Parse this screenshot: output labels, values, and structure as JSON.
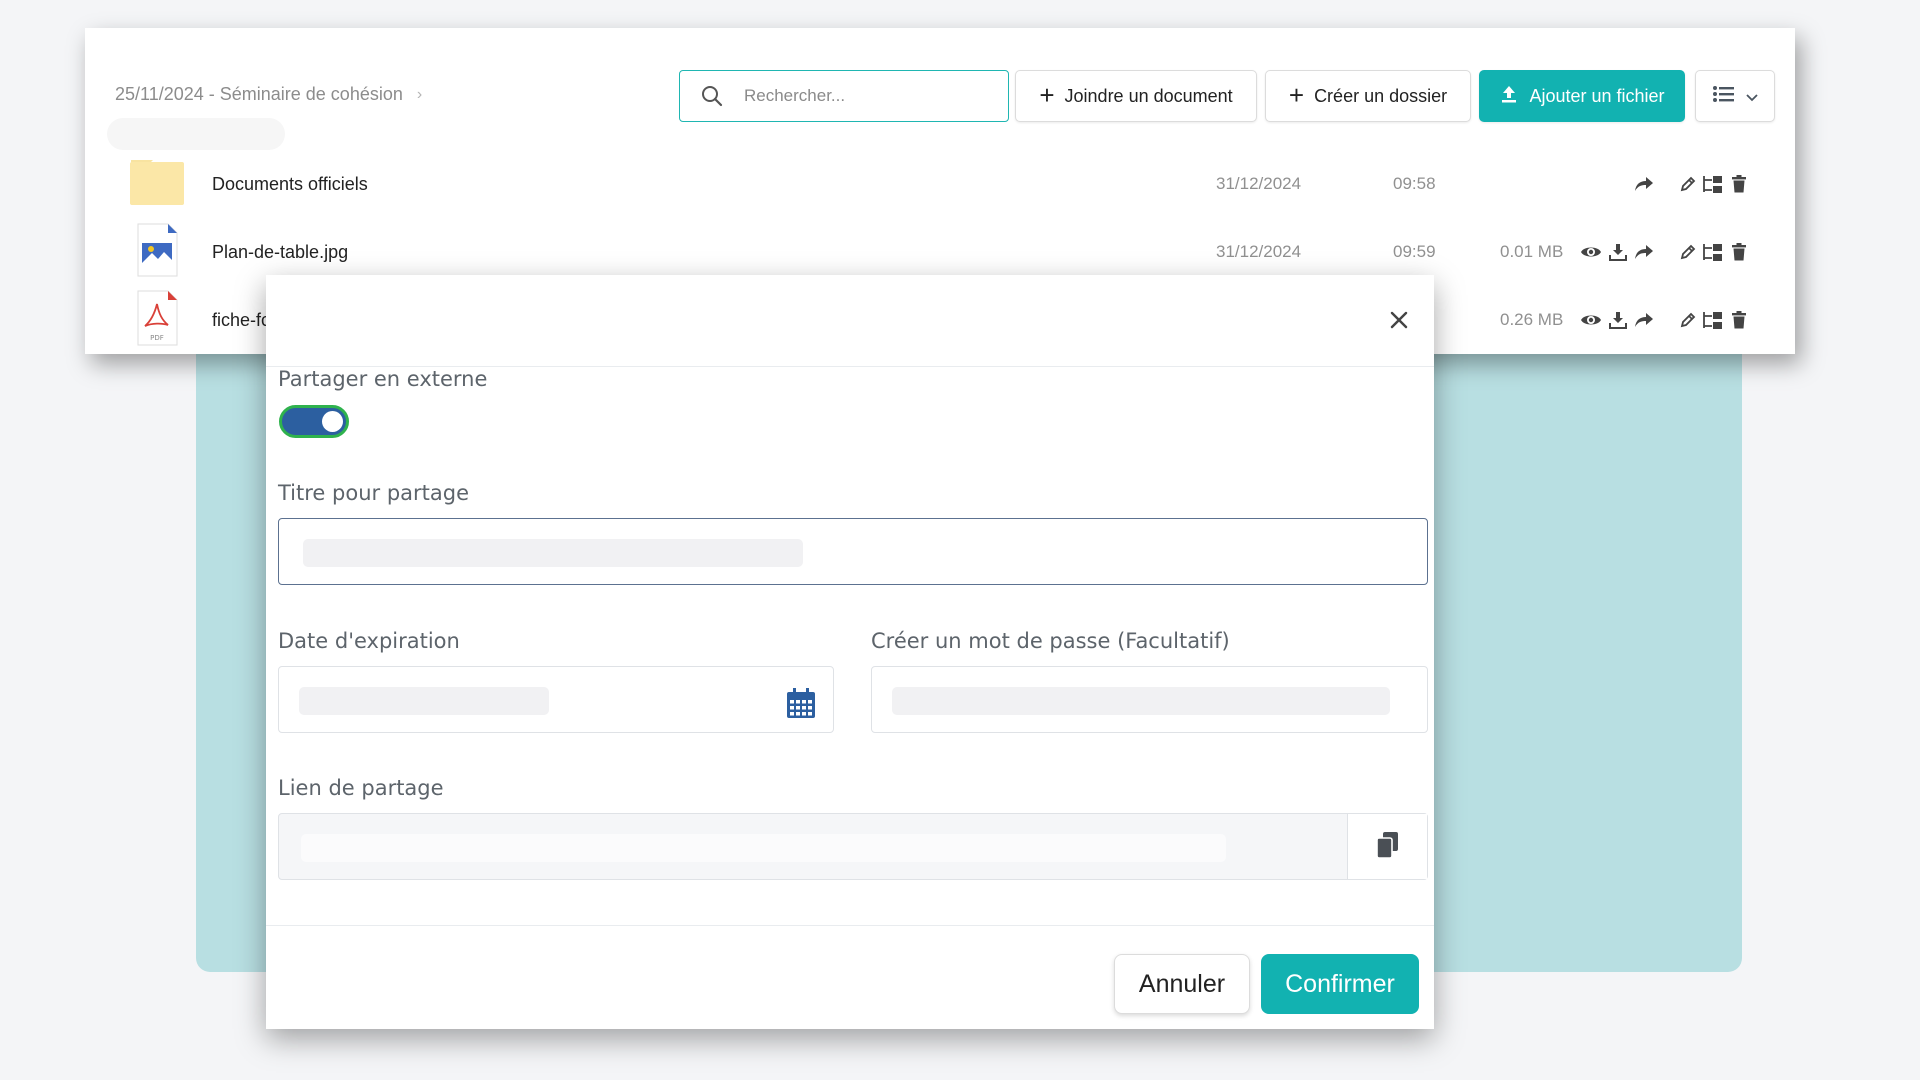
{
  "breadcrumb": {
    "text": "25/11/2024 - Séminaire de cohésion",
    "chevron": "›"
  },
  "search": {
    "placeholder": "Rechercher..."
  },
  "toolbar": {
    "joindre_label": "Joindre un document",
    "dossier_label": "Créer un dossier",
    "ajouter_label": "Ajouter un fichier",
    "plus": "+"
  },
  "files": [
    {
      "name": "Documents officiels",
      "date": "31/12/2024",
      "time": "09:58",
      "size": "",
      "type": "folder"
    },
    {
      "name": "Plan-de-table.jpg",
      "date": "31/12/2024",
      "time": "09:59",
      "size": "0.01 MB",
      "type": "image"
    },
    {
      "name": "fiche-fc",
      "date": "",
      "time": "",
      "size": "0.26 MB",
      "type": "pdf"
    }
  ],
  "pdf_badge": "PDF",
  "modal": {
    "share_external_label": "Partager en externe",
    "share_external_enabled": true,
    "title_label": "Titre pour partage",
    "expiration_label": "Date d'expiration",
    "password_label": "Créer un mot de passe (Facultatif)",
    "link_label": "Lien de partage",
    "cancel_label": "Annuler",
    "confirm_label": "Confirmer"
  },
  "colors": {
    "accent": "#12b2b1",
    "teal_backdrop": "#b8dfe2",
    "toggle_on": "#2c5fa0",
    "calendar_icon": "#2c5fa0"
  }
}
